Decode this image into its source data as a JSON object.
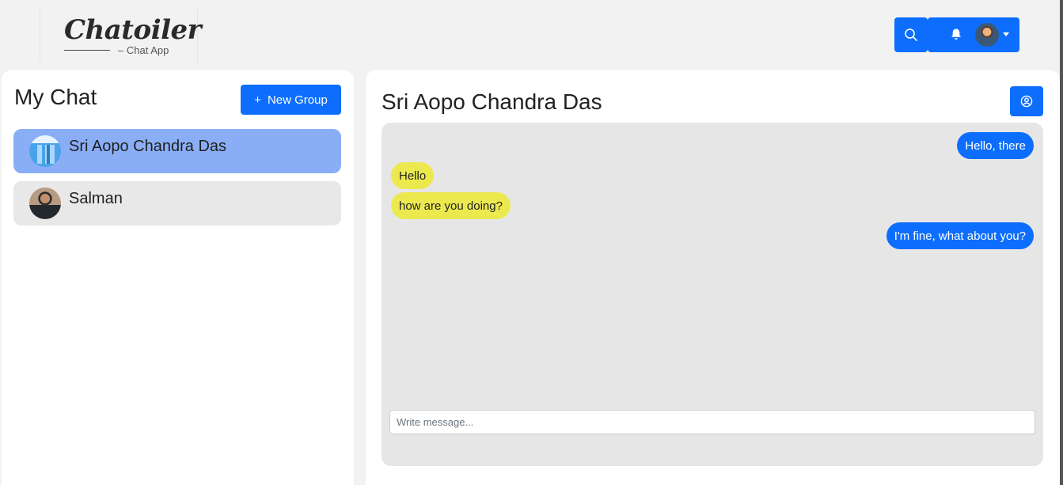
{
  "header": {
    "logo_title": "Chatoiler",
    "logo_subtitle": "– Chat App",
    "search_icon": "search-icon",
    "bell_icon": "bell-icon"
  },
  "sidebar": {
    "title": "My Chat",
    "new_group_plus": "+",
    "new_group_label": "New Group",
    "chats": [
      {
        "name": "Sri Aopo Chandra Das",
        "active": true
      },
      {
        "name": "Salman",
        "active": false
      }
    ]
  },
  "chat": {
    "title": "Sri Aopo Chandra Das",
    "profile_icon": "user-circle-icon",
    "messages": [
      {
        "text": "Hello, there",
        "direction": "sent"
      },
      {
        "text": "Hello",
        "direction": "received"
      },
      {
        "text": "how are you doing?",
        "direction": "received"
      },
      {
        "text": "I'm fine, what about you?",
        "direction": "sent"
      }
    ],
    "input_placeholder": "Write message..."
  },
  "colors": {
    "accent": "#0d6efd",
    "active_chat": "#8aaef6",
    "received_bubble": "#ece94e",
    "messages_bg": "#e6e6e6"
  }
}
